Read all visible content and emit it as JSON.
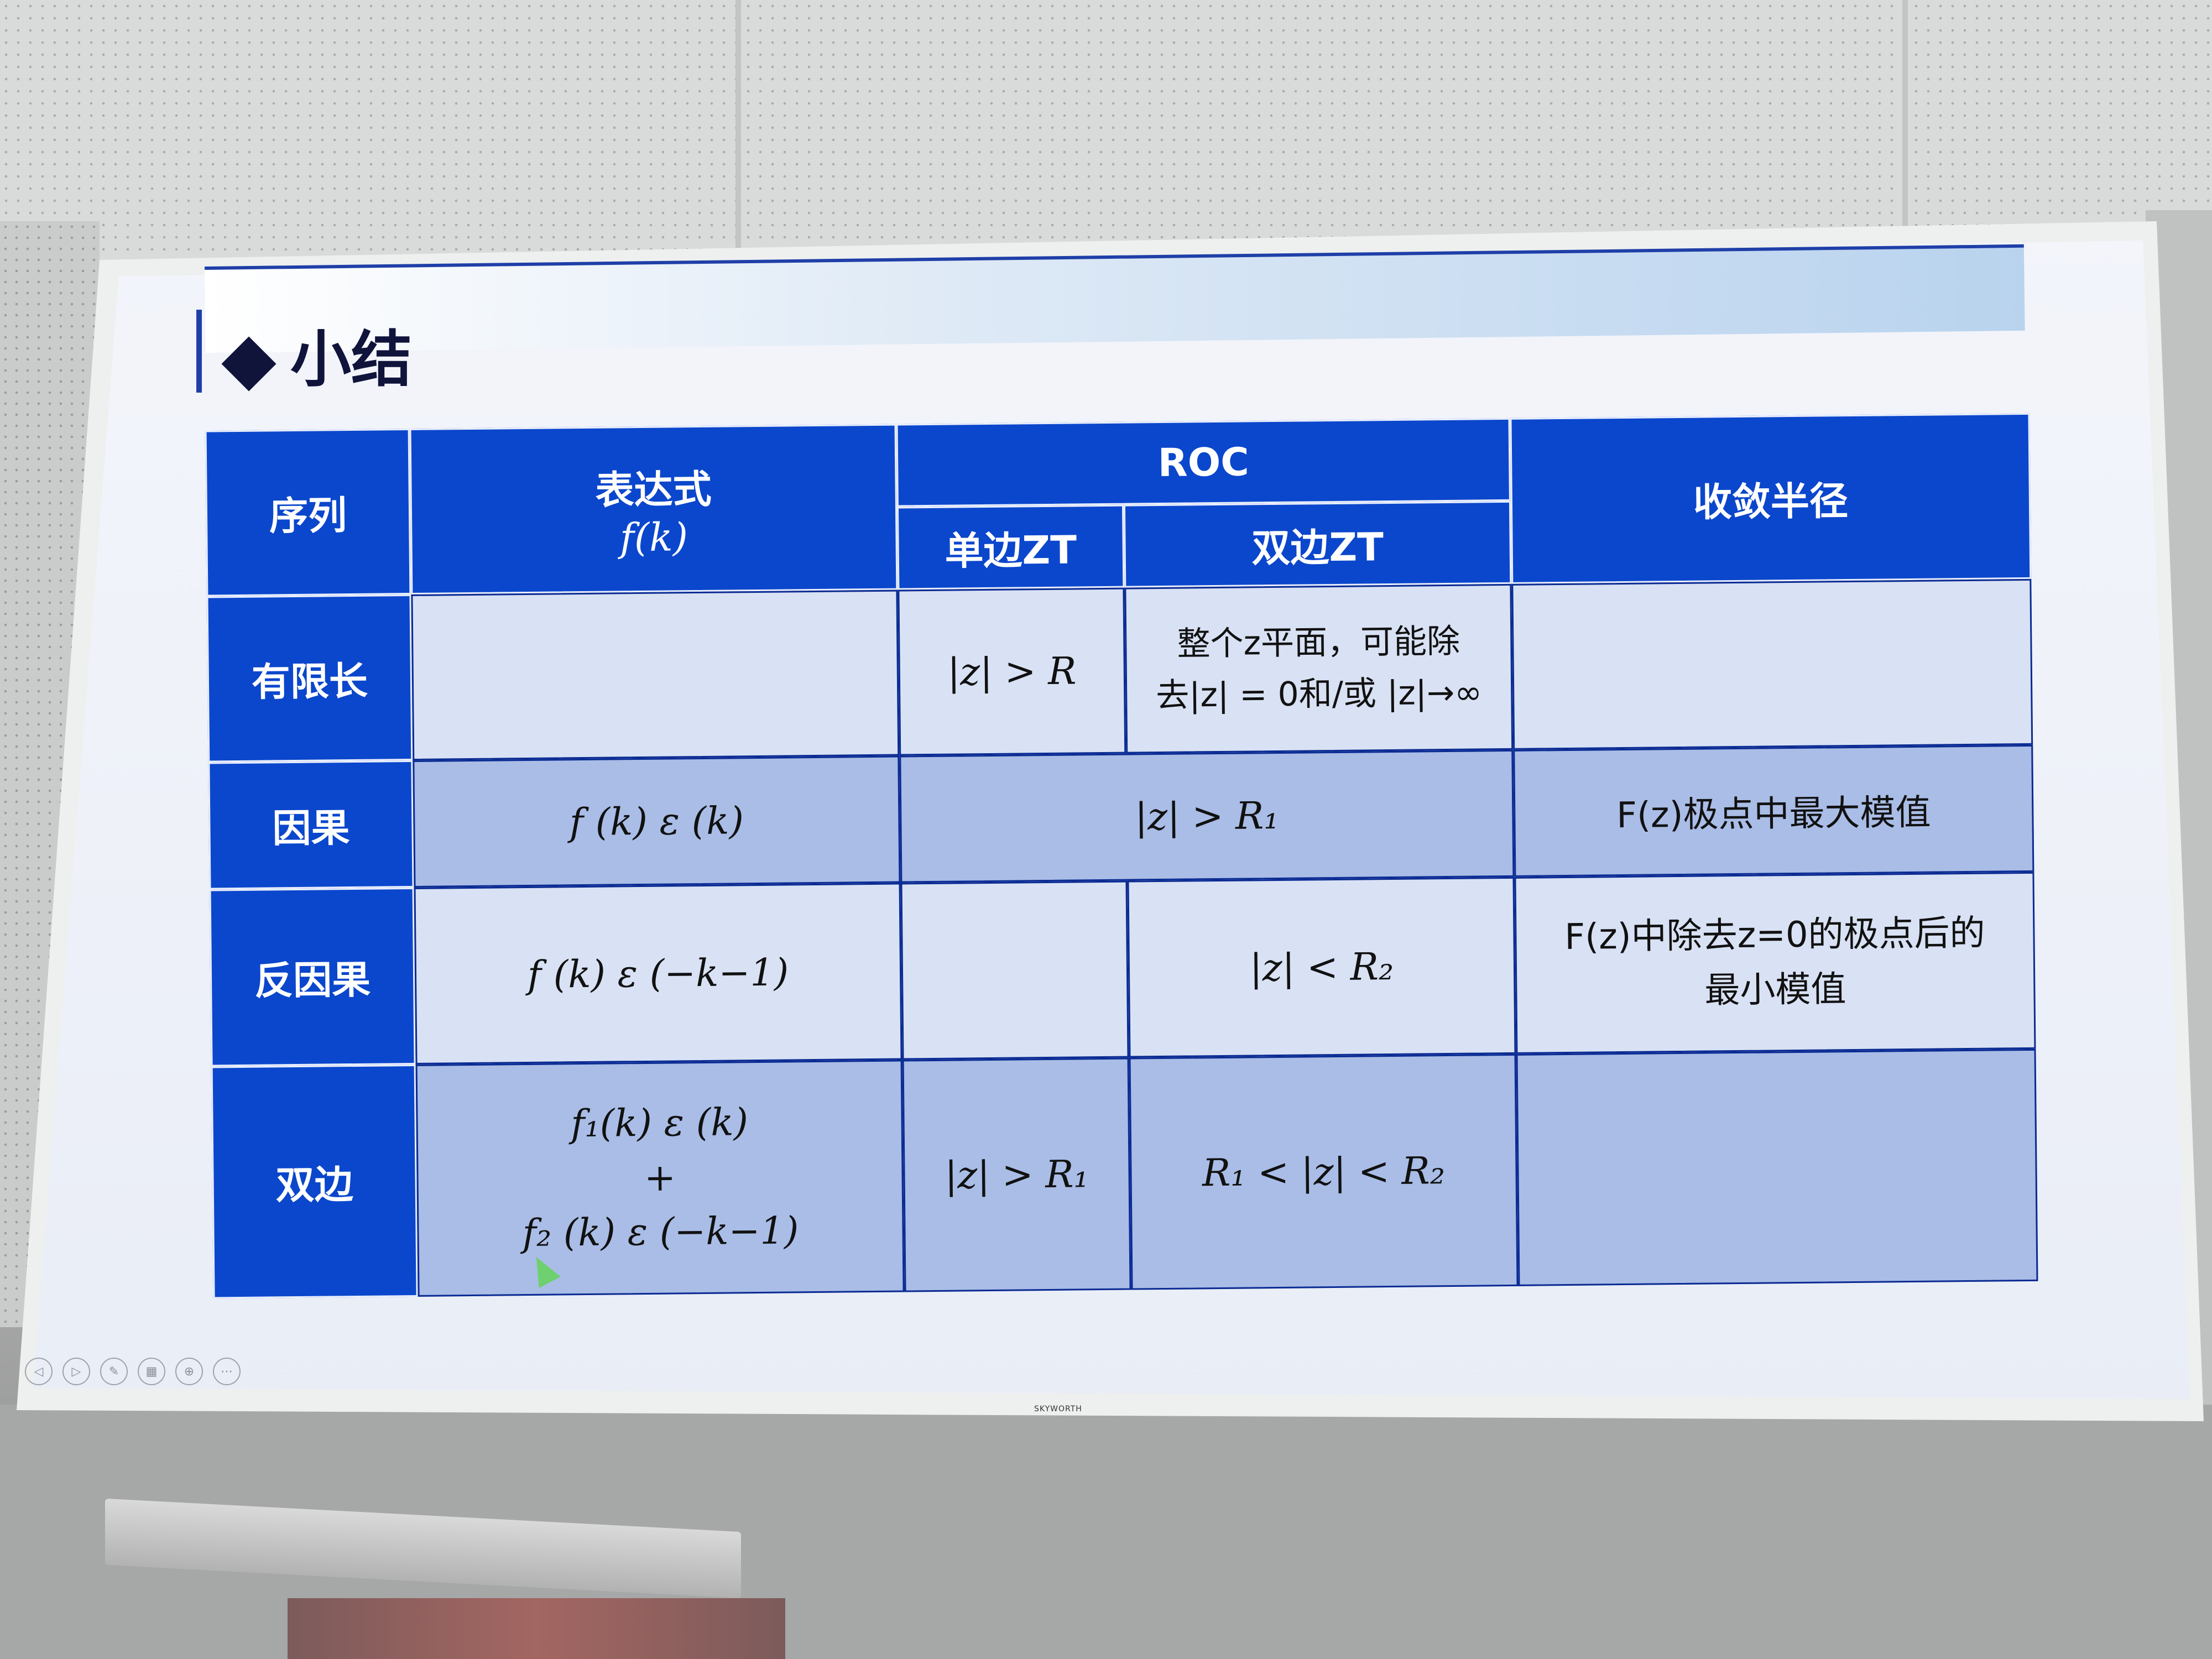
{
  "slide": {
    "title": "小结",
    "badge": "",
    "table": {
      "headers": {
        "sequence": "序列",
        "expression": "表达式",
        "expression_sub": "f(k)",
        "roc": "ROC",
        "roc_single": "单边ZT",
        "roc_double": "双边ZT",
        "radius": "收敛半径"
      },
      "rows": [
        {
          "name": "有限长",
          "expr": "",
          "single": "|z| > R",
          "double_line1": "整个z平面，可能除",
          "double_line2": "去|z| = 0和/或 |z|→∞",
          "radius": ""
        },
        {
          "name": "因果",
          "expr": "f (k) ε (k)",
          "merged_roc": "|z| > R₁",
          "radius": "F(z)极点中最大模值"
        },
        {
          "name": "反因果",
          "expr": "f (k) ε (−k−1)",
          "single": "",
          "double": "|z| < R₂",
          "radius_line1": "F(z)中除去z=0的极点后的",
          "radius_line2": "最小模值"
        },
        {
          "name": "双边",
          "expr_line1": "f₁(k) ε (k)",
          "expr_line2": "+",
          "expr_line3": "f₂ (k) ε (−k−1)",
          "single": "|z| > R₁",
          "double": "R₁ < |z| < R₂",
          "radius": ""
        }
      ]
    }
  },
  "device": {
    "brand": "SKYWORTH"
  },
  "nav_icons": [
    "prev-icon",
    "next-icon",
    "pen-icon",
    "slides-icon",
    "zoom-icon",
    "more-icon"
  ]
}
